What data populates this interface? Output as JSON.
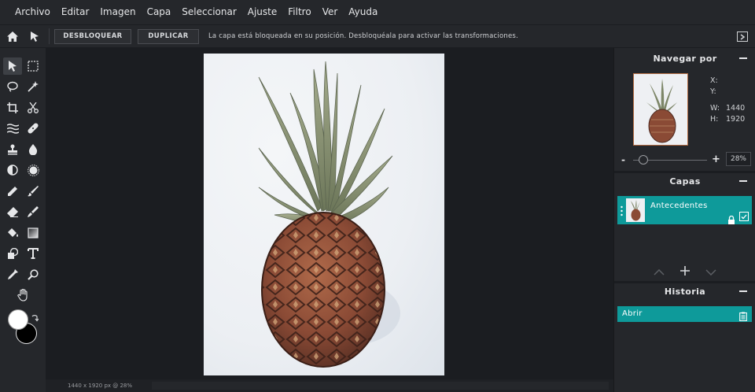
{
  "menu": [
    "Archivo",
    "Editar",
    "Imagen",
    "Capa",
    "Seleccionar",
    "Ajuste",
    "Filtro",
    "Ver",
    "Ayuda"
  ],
  "options": {
    "unlock_label": "DESBLOQUEAR",
    "duplicate_label": "DUPLICAR",
    "message": "La capa está bloqueada en su posición. Desbloquéala para activar las transformaciones."
  },
  "tools": [
    "move-icon",
    "marquee-icon",
    "lasso-icon",
    "magic-wand-icon",
    "crop-icon",
    "scissors-icon",
    "liquify-icon",
    "healing-icon",
    "stamp-icon",
    "blur-icon",
    "dodge-icon",
    "sponge-icon",
    "pencil-icon",
    "brush-icon",
    "eraser-icon",
    "smudge-icon",
    "bucket-icon",
    "gradient-icon",
    "shape-icon",
    "text-icon",
    "eyedropper-icon",
    "zoom-icon",
    "hand-icon"
  ],
  "colors": {
    "foreground": "#ffffff",
    "background": "#000000",
    "accent": "#0e9a9a"
  },
  "status": {
    "info": "1440 x 1920 px @ 28%"
  },
  "navigator": {
    "title": "Navegar por",
    "x_label": "X:",
    "y_label": "Y:",
    "w_label": "W:",
    "w_value": "1440",
    "h_label": "H:",
    "h_value": "1920",
    "zoom_minus": "-",
    "zoom_plus": "+",
    "zoom_value": "28%"
  },
  "layers": {
    "title": "Capas",
    "items": [
      {
        "name": "Antecedentes"
      }
    ]
  },
  "history": {
    "title": "Historia",
    "items": [
      {
        "name": "Abrir"
      }
    ]
  }
}
